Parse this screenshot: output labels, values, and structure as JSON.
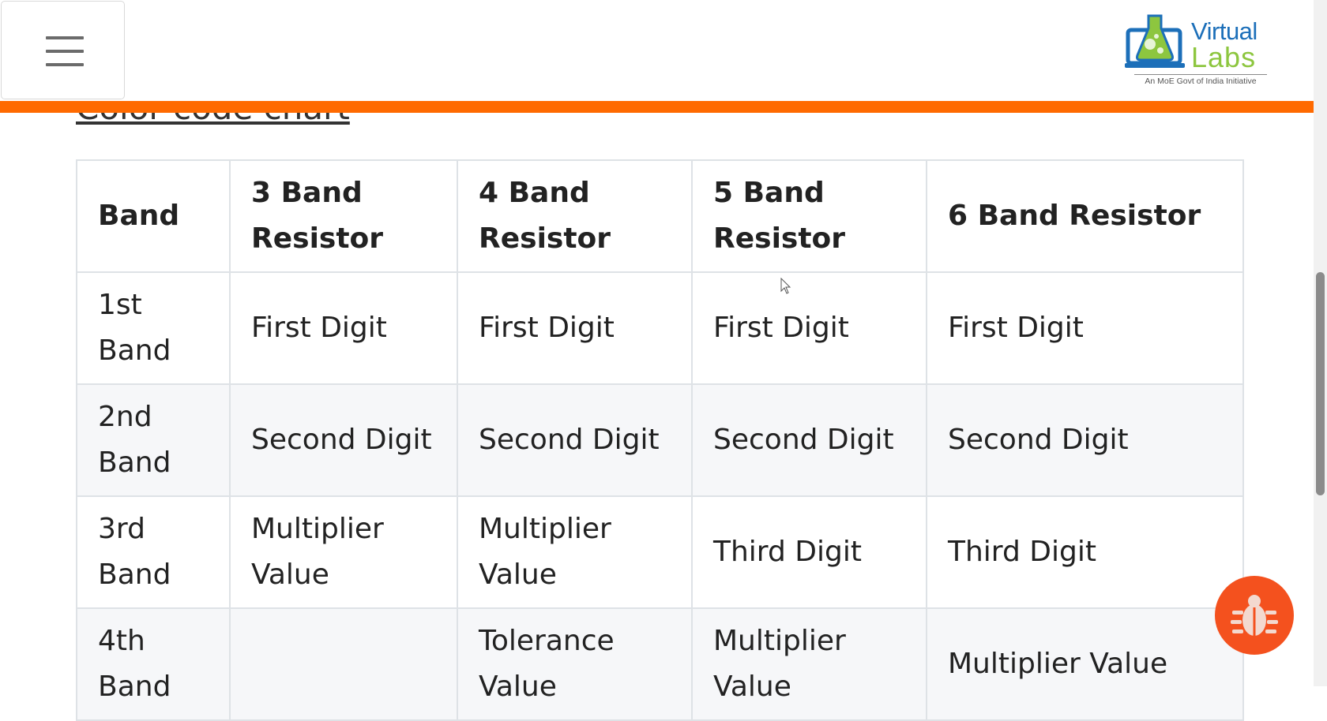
{
  "header": {
    "menu_label": "Menu",
    "logo": {
      "line1": "Virtual",
      "line2": "Labs",
      "tagline": "An MoE Govt of India Initiative"
    }
  },
  "page": {
    "heading": "Color code chart"
  },
  "table": {
    "headers": [
      "Band",
      "3 Band Resistor",
      "4 Band Resistor",
      "5 Band Resistor",
      "6 Band Resistor"
    ],
    "rows": [
      {
        "band": "1st Band",
        "c3": "First Digit",
        "c4": "First Digit",
        "c5": "First Digit",
        "c6": "First Digit"
      },
      {
        "band": "2nd Band",
        "c3": "Second Digit",
        "c4": "Second Digit",
        "c5": "Second Digit",
        "c6": "Second Digit"
      },
      {
        "band": "3rd Band",
        "c3": "Multiplier Value",
        "c4": "Multiplier Value",
        "c5": "Third Digit",
        "c6": "Third Digit"
      },
      {
        "band": "4th Band",
        "c3": "",
        "c4": "Tolerance Value",
        "c5": "Multiplier Value",
        "c6": "Multiplier Value"
      }
    ]
  },
  "colors": {
    "accent_bar": "#ff6a00",
    "bug_button": "#f4511e",
    "logo_blue": "#1c6fb9",
    "logo_green": "#8dc63f"
  },
  "icons": {
    "menu": "hamburger-icon",
    "report_bug": "bug-icon"
  }
}
